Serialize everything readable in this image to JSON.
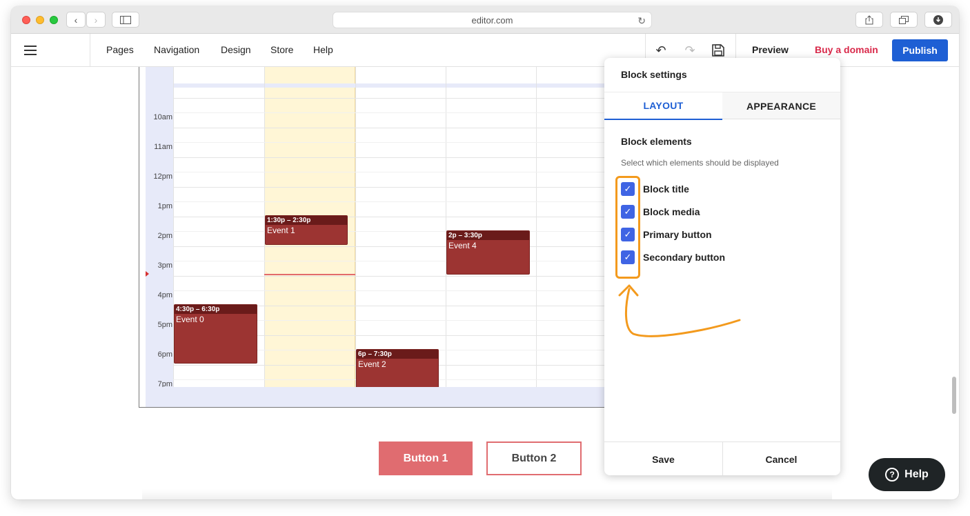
{
  "browser": {
    "url": "editor.com",
    "icons": [
      "back-icon",
      "forward-icon",
      "sidebar-icon",
      "reload-icon",
      "share-icon",
      "tabs-icon",
      "download-icon"
    ]
  },
  "toolbar": {
    "menu": [
      "Pages",
      "Navigation",
      "Design",
      "Store",
      "Help"
    ],
    "preview": "Preview",
    "buy_domain": "Buy a domain",
    "publish": "Publish"
  },
  "calendar": {
    "times": [
      "10am",
      "11am",
      "12pm",
      "1pm",
      "2pm",
      "3pm",
      "4pm",
      "5pm",
      "6pm",
      "7pm"
    ],
    "events": [
      {
        "time": "1:30p – 2:30p",
        "name": "Event 1"
      },
      {
        "time": "2p – 3:30p",
        "name": "Event 4"
      },
      {
        "time": "4:30p – 6:30p",
        "name": "Event 0"
      },
      {
        "time": "6p – 7:30p",
        "name": "Event 2"
      }
    ]
  },
  "page_buttons": {
    "button1": "Button 1",
    "button2": "Button 2"
  },
  "panel": {
    "title": "Block settings",
    "tabs": [
      "LAYOUT",
      "APPEARANCE"
    ],
    "active_tab": "LAYOUT",
    "section_title": "Block elements",
    "section_subtitle": "Select which elements should be displayed",
    "options": [
      {
        "label": "Block title",
        "checked": true
      },
      {
        "label": "Block media",
        "checked": true
      },
      {
        "label": "Primary button",
        "checked": true
      },
      {
        "label": "Secondary button",
        "checked": true
      }
    ],
    "save": "Save",
    "cancel": "Cancel"
  },
  "help_widget": {
    "label": "Help"
  },
  "colors": {
    "accent": "#1e5fd4",
    "checkbox": "#3f64e4",
    "buy_domain": "#d9294a",
    "event": "#9c3432",
    "annotation": "#f39a1d",
    "button1": "#e06c70"
  }
}
